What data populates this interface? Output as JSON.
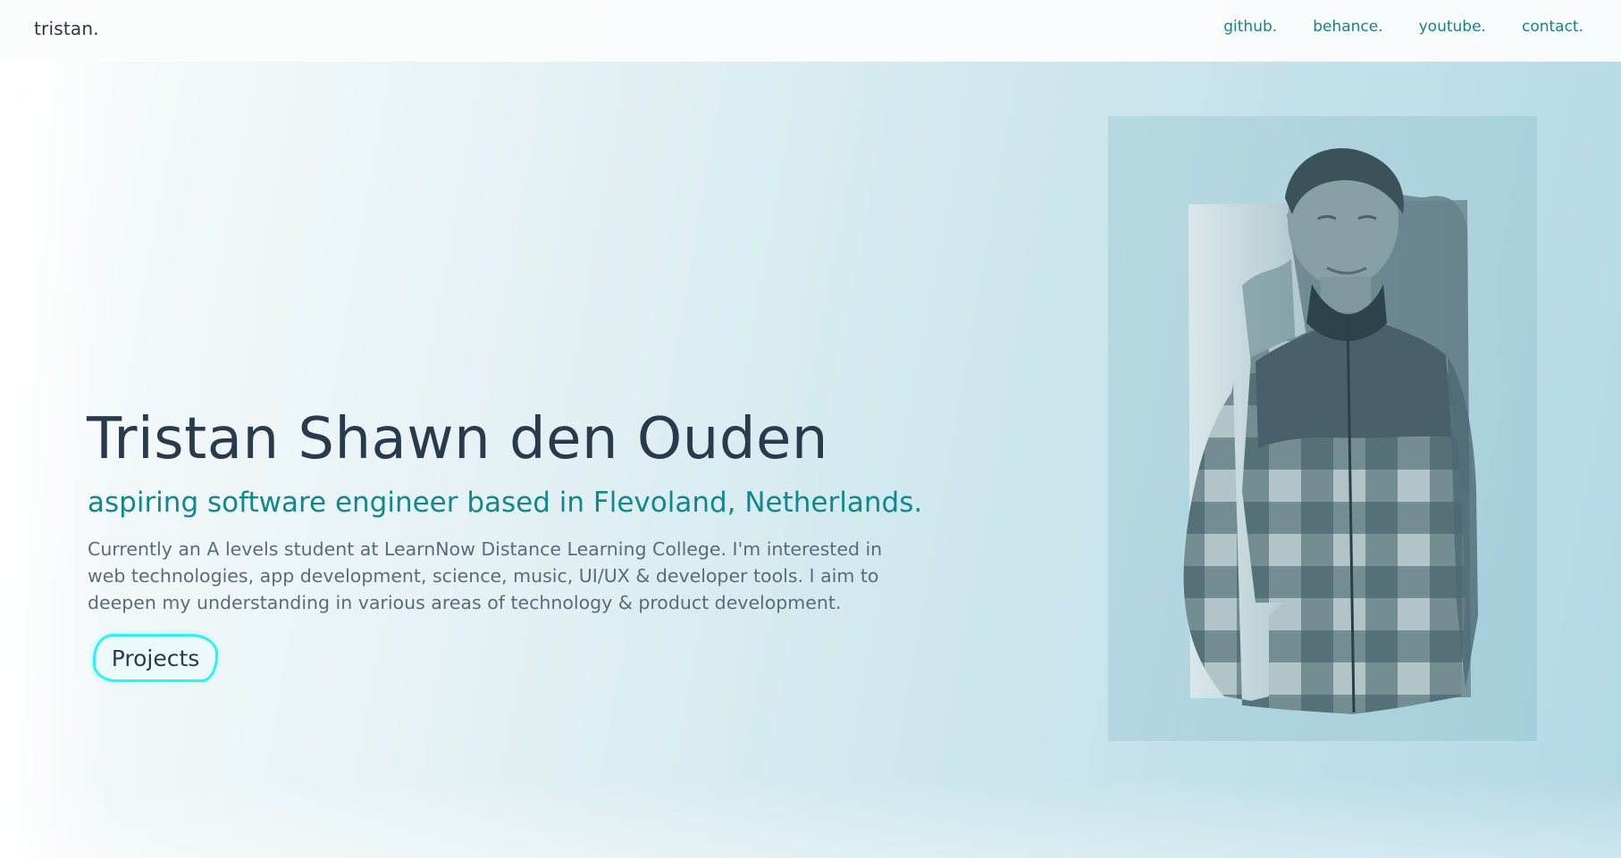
{
  "header": {
    "logo": "tristan.",
    "nav": [
      {
        "label": "github."
      },
      {
        "label": "behance."
      },
      {
        "label": "youtube."
      },
      {
        "label": "contact."
      }
    ]
  },
  "hero": {
    "title": "Tristan Shawn den Ouden",
    "subtitle": "aspiring software engineer based in Flevoland, Netherlands.",
    "description": "Currently an A levels student at LearnNow Distance Learning College. I'm interested in web technologies, app development, science, music, UI/UX & developer tools. I aim to deepen my understanding in various areas of technology & product development.",
    "cta_label": "Projects"
  },
  "colors": {
    "accent": "#12878f",
    "nav_link": "#17808a",
    "heading": "#2a3a4d",
    "body_text": "#5b6b78",
    "button_border": "#2ff0f4"
  }
}
